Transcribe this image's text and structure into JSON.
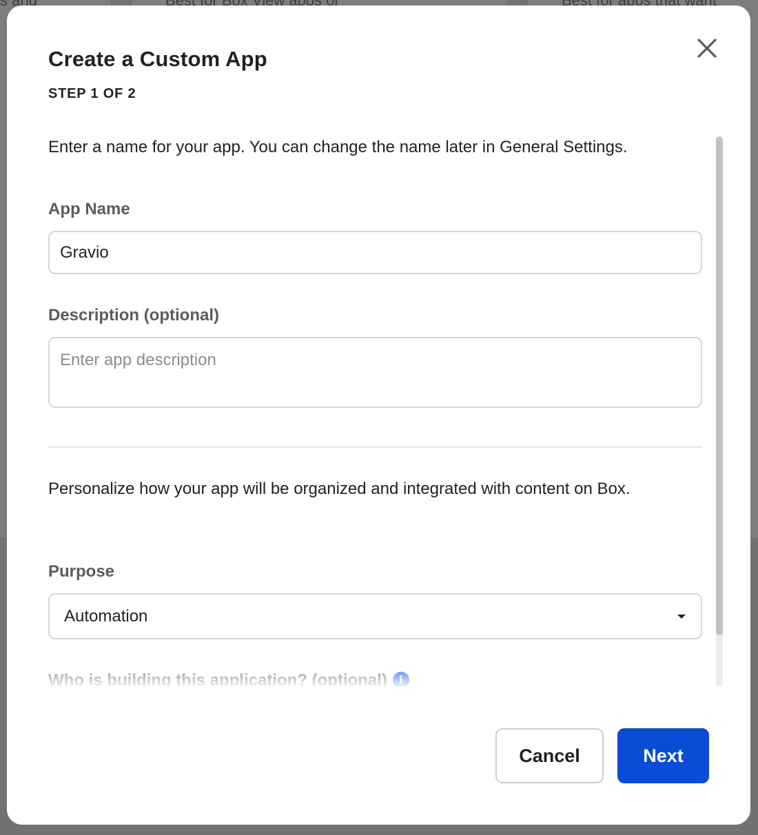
{
  "background": {
    "texts": [
      "s and",
      "Best for Box View apps or",
      "Best for apps that want"
    ]
  },
  "modal": {
    "title": "Create a Custom App",
    "step": "STEP 1 OF 2",
    "close_icon": "close-icon"
  },
  "form": {
    "intro": "Enter a name for your app. You can change the name later in General Settings.",
    "app_name": {
      "label": "App Name",
      "value": "Gravio"
    },
    "description": {
      "label": "Description (optional)",
      "value": "",
      "placeholder": "Enter app description"
    },
    "personalize_text": "Personalize how your app will be organized and integrated with content on Box.",
    "purpose": {
      "label": "Purpose",
      "selected": "Automation",
      "caret_icon": "caret-down-icon"
    },
    "builder": {
      "label": "Who is building this application? (optional)",
      "info_icon": "info-icon"
    }
  },
  "footer": {
    "cancel_label": "Cancel",
    "next_label": "Next"
  },
  "colors": {
    "accent": "#0b4cd6",
    "text": "#222222",
    "label": "#5c5c5c",
    "border": "#d6d6d6"
  }
}
